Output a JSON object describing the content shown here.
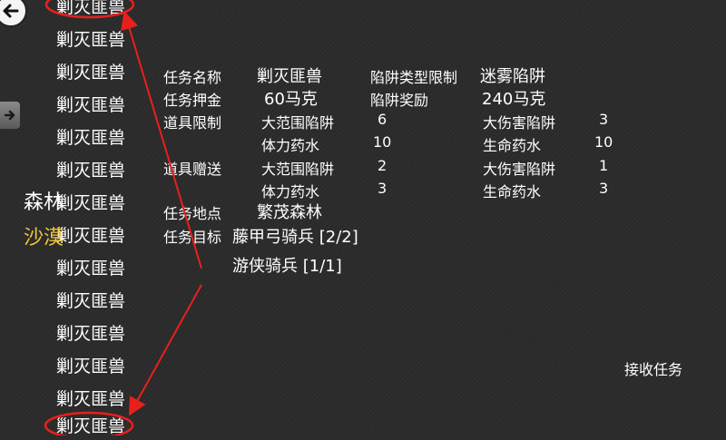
{
  "quest_list": {
    "items": [
      "剿灭匪兽",
      "剿灭匪兽",
      "剿灭匪兽",
      "剿灭匪兽",
      "剿灭匪兽",
      "剿灭匪兽",
      "剿灭匪兽",
      "剿灭匪兽",
      "剿灭匪兽",
      "剿灭匪兽",
      "剿灭匪兽",
      "剿灭匪兽",
      "剿灭匪兽",
      "剿灭匪兽"
    ]
  },
  "regions": {
    "forest": "森林",
    "desert": "沙漠",
    "selected": "desert"
  },
  "details": {
    "name_label": "任务名称",
    "name_value": "剿灭匪兽",
    "trap_type_label": "陷阱类型限制",
    "trap_type_value": "迷雾陷阱",
    "deposit_label": "任务押金",
    "deposit_value": "60马克",
    "trap_reward_label": "陷阱奖励",
    "trap_reward_value": "240马克",
    "item_limit_label": "道具限制",
    "item_limit": [
      {
        "name": "大范围陷阱",
        "count": "6"
      },
      {
        "name": "大伤害陷阱",
        "count": "3"
      },
      {
        "name": "体力药水",
        "count": "10"
      },
      {
        "name": "生命药水",
        "count": "10"
      }
    ],
    "item_gift_label": "道具赠送",
    "item_gift": [
      {
        "name": "大范围陷阱",
        "count": "2"
      },
      {
        "name": "大伤害陷阱",
        "count": "1"
      },
      {
        "name": "体力药水",
        "count": "3"
      },
      {
        "name": "生命药水",
        "count": "3"
      }
    ],
    "location_label": "任务地点",
    "location_value": "繁茂森林",
    "target_label": "任务目标",
    "targets": [
      "藤甲弓骑兵 [2/2]",
      "游侠骑兵 [1/1]"
    ]
  },
  "accept_label": "接收任务",
  "colors": {
    "annotation": "#e8201c",
    "selected_region": "#f0c63a"
  }
}
